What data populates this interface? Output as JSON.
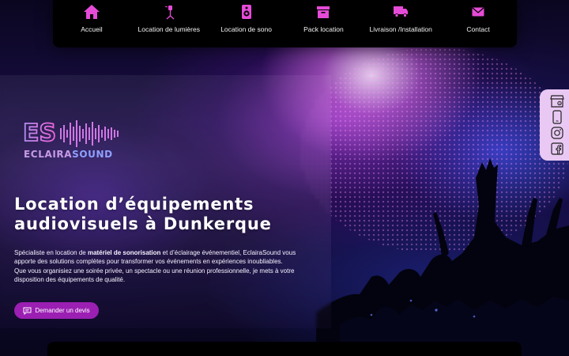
{
  "nav": {
    "items": [
      {
        "label": "Accueil",
        "icon": "home-icon"
      },
      {
        "label": "Location de lumières",
        "icon": "spotlight-icon"
      },
      {
        "label": "Location de sono",
        "icon": "speaker-icon"
      },
      {
        "label": "Pack location",
        "icon": "box-icon"
      },
      {
        "label": "Livraison /Installation",
        "icon": "truck-icon"
      },
      {
        "label": "Contact",
        "icon": "mail-icon"
      }
    ]
  },
  "logo": {
    "monogram": "ES",
    "brand_part1": "ECLAIRA",
    "brand_part2": "SOUND"
  },
  "hero": {
    "title": "Location d’équipements audiovisuels à Dunkerque",
    "desc_p1_before": "Spécialiste en location de ",
    "desc_p1_bold": "matériel de sonorisation",
    "desc_p1_after": " et d’éclairage événementiel, EclairaSound vous apporte des solutions complètes pour transformer vos événements en expériences inoubliables.",
    "desc_p2": "Que vous organisiez une soirée privée, un spectacle ou une réunion professionnelle, je mets à votre disposition des équipements de qualité.",
    "button_label": "Demander un devis"
  },
  "social": [
    "store-icon",
    "phone-icon",
    "instagram-icon",
    "facebook-icon"
  ],
  "colors": {
    "accent_pink": "#e64bd8",
    "button_purple": "#9b1fb3",
    "social_bg": "#e9c9f4",
    "nav_bg": "#000000"
  }
}
